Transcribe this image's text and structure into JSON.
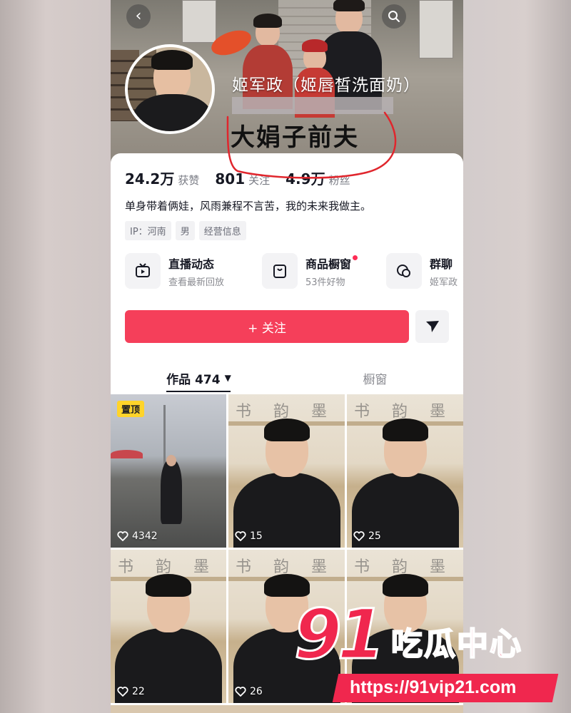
{
  "profile": {
    "username": "姬军政（姬唇皙洗面奶）",
    "annotation": "大娟子前夫",
    "stats": [
      {
        "value": "24.2万",
        "label": "获赞"
      },
      {
        "value": "801",
        "label": "关注"
      },
      {
        "value": "4.9万",
        "label": "粉丝"
      }
    ],
    "bio": "单身带着俩娃，风雨兼程不言苦，我的未来我做主。",
    "tags": [
      "IP：河南",
      "男",
      "经营信息"
    ]
  },
  "features": [
    {
      "title": "直播动态",
      "subtitle": "查看最新回放",
      "icon": "tv-icon"
    },
    {
      "title": "商品橱窗",
      "subtitle": "53件好物",
      "icon": "bag-icon",
      "badge": true
    },
    {
      "title": "群聊",
      "subtitle": "姬军政",
      "icon": "chat-icon"
    }
  ],
  "actions": {
    "follow_label": "+ 关注",
    "share_icon": "send-icon"
  },
  "tabs": {
    "works_label": "作品 474",
    "showcase_label": "橱窗"
  },
  "videos": [
    {
      "likes": "4342",
      "pinned_label": "置顶"
    },
    {
      "likes": "15"
    },
    {
      "likes": "25"
    },
    {
      "likes": "22"
    },
    {
      "likes": "26"
    },
    {
      "likes": ""
    }
  ],
  "watermark": {
    "number": "91",
    "text": "吃瓜中心",
    "url": "https://91vip21.com"
  },
  "colors": {
    "accent": "#f53f5a",
    "pin_badge": "#ffd42a",
    "annotation_circle": "#e0262d"
  }
}
